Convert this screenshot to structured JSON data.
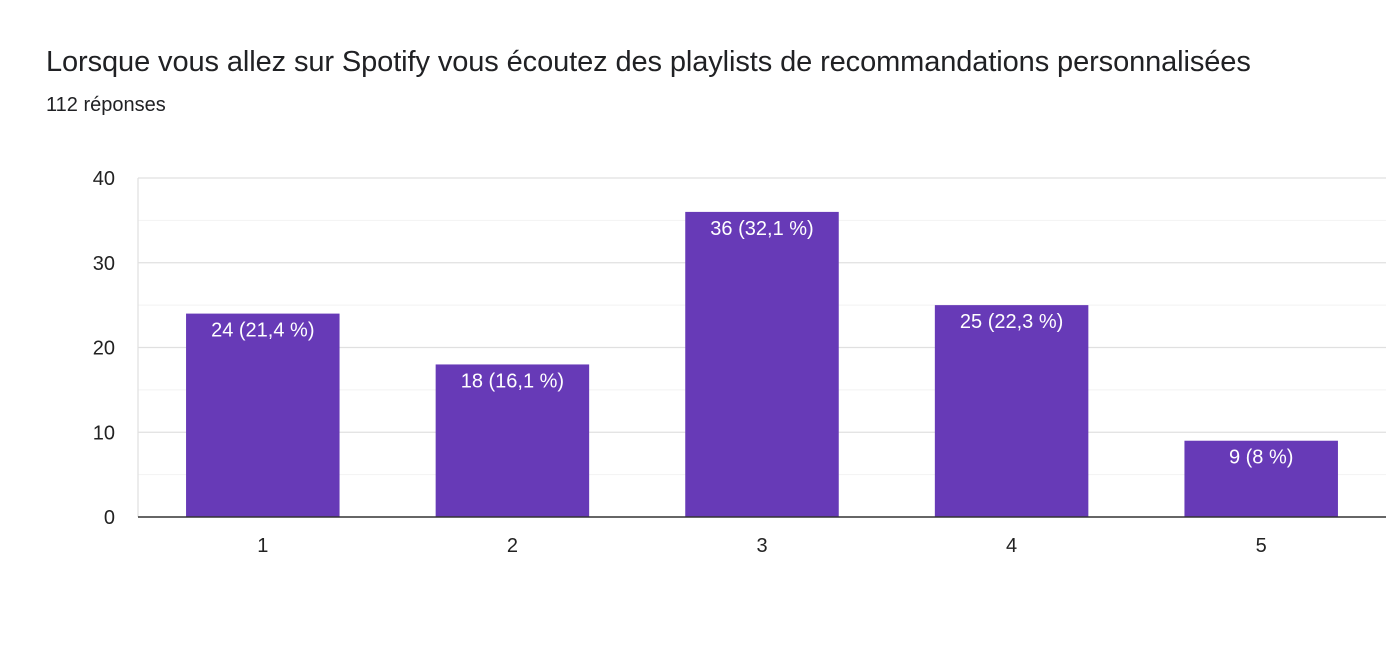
{
  "header": {
    "title": "Lorsque vous allez sur Spotify vous écoutez des playlists de recommandations personnalisées",
    "subtitle": "112 réponses"
  },
  "colors": {
    "bar": "#673ab7",
    "grid_major": "#e0e0e0",
    "grid_minor": "#f2f2f2",
    "axis": "#333333"
  },
  "chart_data": {
    "type": "bar",
    "categories": [
      "1",
      "2",
      "3",
      "4",
      "5"
    ],
    "values": [
      24,
      18,
      36,
      25,
      9
    ],
    "data_labels": [
      "24 (21,4 %)",
      "18 (16,1 %)",
      "36 (32,1 %)",
      "25 (22,3 %)",
      "9 (8 %)"
    ],
    "ylim": [
      0,
      40
    ],
    "yticks": [
      0,
      10,
      20,
      30,
      40
    ],
    "grid": true
  }
}
